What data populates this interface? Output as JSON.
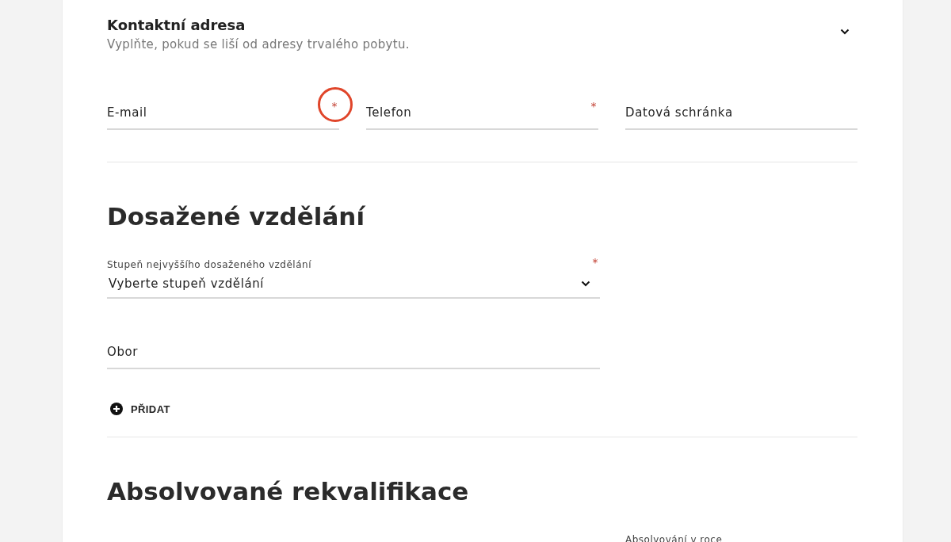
{
  "contact": {
    "title": "Kontaktní adresa",
    "subtitle": "Vyplňte, pokud se liší od adresy trvalého pobytu.",
    "expanded": false,
    "fields": [
      {
        "label": "E-mail",
        "required_mark": "*",
        "highlighted": true
      },
      {
        "label": "Telefon",
        "required_mark": "*",
        "highlighted": false
      },
      {
        "label": "Datová schránka",
        "highlighted": false
      }
    ]
  },
  "education": {
    "heading": "Dosažené vzdělání",
    "fields": [
      {
        "kind": "select",
        "label": "Stupeň nejvyššího dosaženého vzdělání",
        "value": "Vyberte stupeň vzdělání",
        "required_mark": "*"
      },
      {
        "kind": "text",
        "label": "Obor"
      }
    ],
    "add_button": "PŘIDAT"
  },
  "retraining": {
    "heading": "Absolvované rekvalifikace",
    "fields": [
      {
        "kind": "floating",
        "label": "Absolvování v roce"
      }
    ]
  }
}
